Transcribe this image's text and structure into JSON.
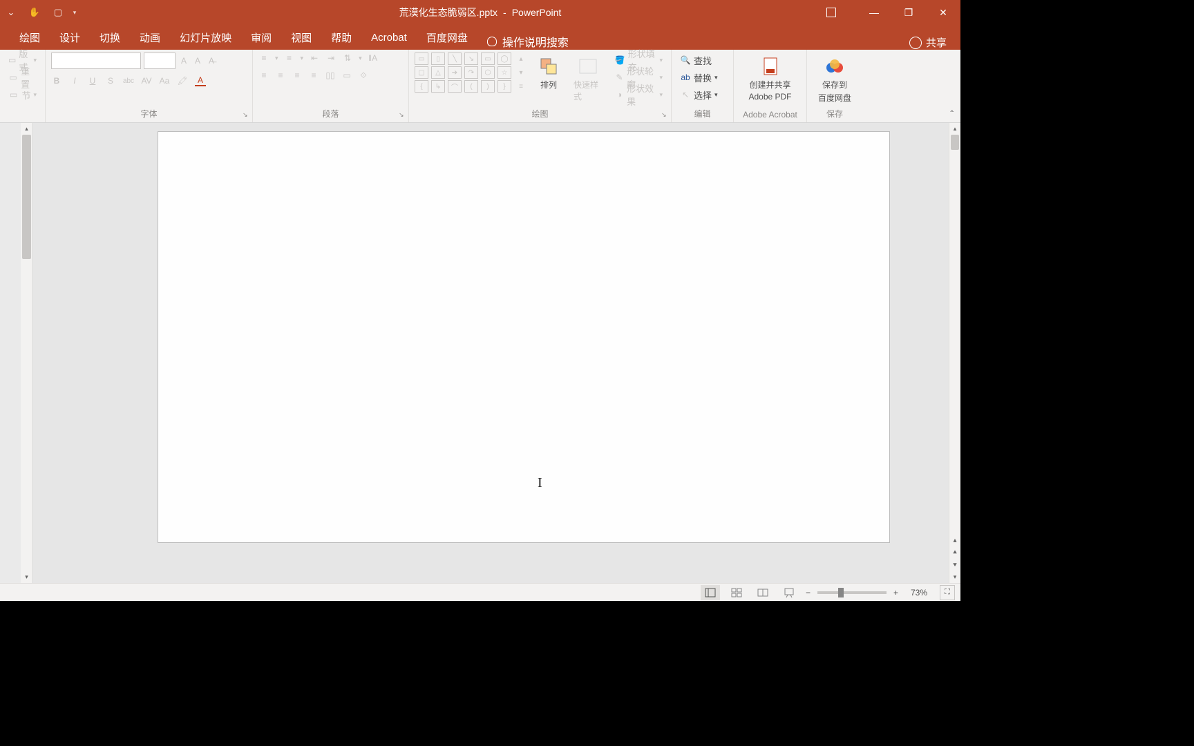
{
  "title": {
    "filename": "荒漠化生态脆弱区.pptx",
    "sep": "-",
    "app": "PowerPoint"
  },
  "tabs": [
    "绘图",
    "设计",
    "切换",
    "动画",
    "幻灯片放映",
    "审阅",
    "视图",
    "帮助",
    "Acrobat",
    "百度网盘"
  ],
  "tellme": "操作说明搜索",
  "share": "共享",
  "slides_group": {
    "layout": "版式",
    "reset": "重置",
    "section": "节"
  },
  "font_group": {
    "label": "字体",
    "bold": "B",
    "italic": "I",
    "underline": "U",
    "strike": "S",
    "abc": "abc",
    "av": "AV",
    "aa": "Aa",
    "grow": "A",
    "shrink": "A",
    "clear": "Aᵥ"
  },
  "para_group": {
    "label": "段落"
  },
  "draw_group": {
    "label": "绘图",
    "arrange": "排列",
    "quick_styles": "快速样式",
    "shape_fill": "形状填充",
    "shape_outline": "形状轮廓",
    "shape_effects": "形状效果"
  },
  "edit_group": {
    "label": "编辑",
    "find": "查找",
    "replace": "替换",
    "select": "选择"
  },
  "adobe_group": {
    "label": "Adobe Acrobat",
    "btn1a": "创建并共享",
    "btn1b": "Adobe PDF"
  },
  "baidu_group": {
    "label": "保存",
    "btn1a": "保存到",
    "btn1b": "百度网盘"
  },
  "zoom": {
    "pct": "73%"
  }
}
